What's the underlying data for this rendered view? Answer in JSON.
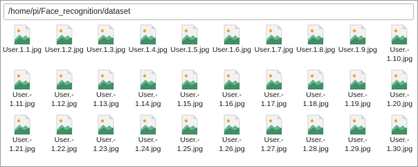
{
  "location": {
    "path": "/home/pi/Face_recognition/dataset"
  },
  "icon": {
    "name": "image-file-icon",
    "colors": {
      "page": "#f2f2f2",
      "fold": "#d6d6d6",
      "sun": "#e8a43a",
      "mountain_back": "#6cb48e",
      "mountain_front": "#3f8f66"
    }
  },
  "files": [
    {
      "label": "User.1.1.jpg"
    },
    {
      "label": "User.1.2.jpg"
    },
    {
      "label": "User.1.3.jpg"
    },
    {
      "label": "User.1.4.jpg"
    },
    {
      "label": "User.1.5.jpg"
    },
    {
      "label": "User.1.6.jpg"
    },
    {
      "label": "User.1.7.jpg"
    },
    {
      "label": "User.1.8.jpg"
    },
    {
      "label": "User.1.9.jpg"
    },
    {
      "label": "User.-\n1.10.jpg"
    },
    {
      "label": "User.-\n1.11.jpg"
    },
    {
      "label": "User.-\n1.12.jpg"
    },
    {
      "label": "User.-\n1.13.jpg"
    },
    {
      "label": "User.-\n1.14.jpg"
    },
    {
      "label": "User.-\n1.15.jpg"
    },
    {
      "label": "User.-\n1.16.jpg"
    },
    {
      "label": "User.-\n1.17.jpg"
    },
    {
      "label": "User.-\n1.18.jpg"
    },
    {
      "label": "User.-\n1.19.jpg"
    },
    {
      "label": "User.-\n1.20.jpg"
    },
    {
      "label": "User.-\n1.21.jpg"
    },
    {
      "label": "User.-\n1.22.jpg"
    },
    {
      "label": "User.-\n1.23.jpg"
    },
    {
      "label": "User.-\n1.24.jpg"
    },
    {
      "label": "User.-\n1.25.jpg"
    },
    {
      "label": "User.-\n1.26.jpg"
    },
    {
      "label": "User.-\n1.27.jpg"
    },
    {
      "label": "User.-\n1.28.jpg"
    },
    {
      "label": "User.-\n1.29.jpg"
    },
    {
      "label": "User.-\n1.30.jpg"
    }
  ]
}
